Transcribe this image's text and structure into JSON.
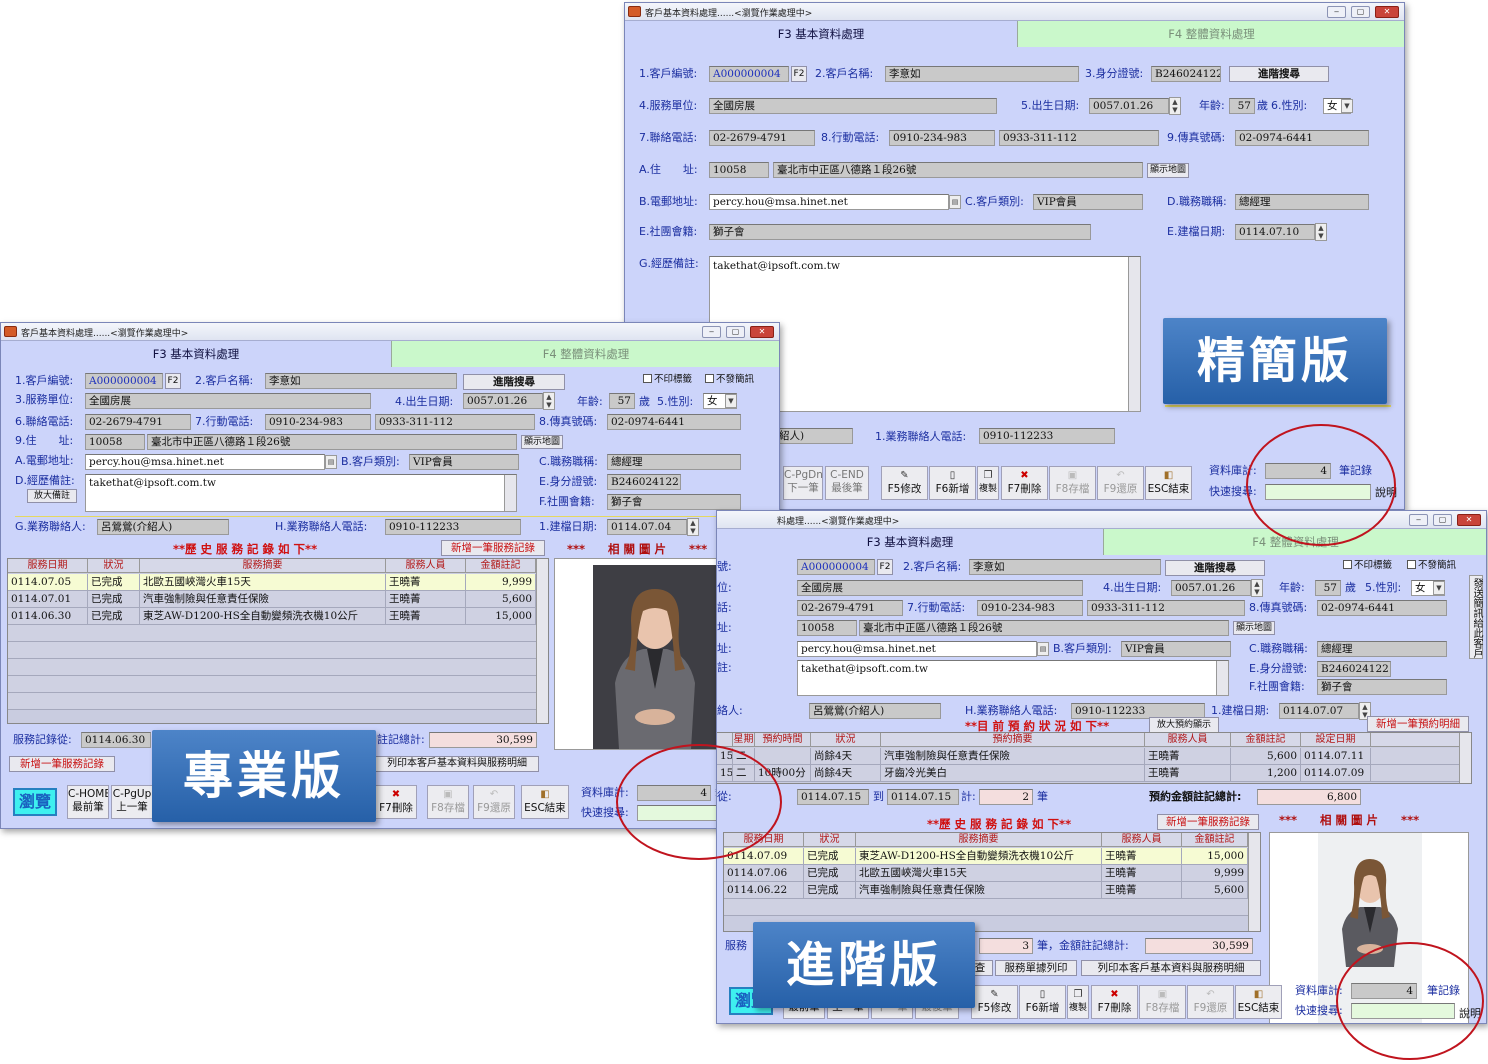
{
  "app": {
    "window_title": "客戶基本資料處理......<瀏覽作業處理中>",
    "tab_f3": "F3 基本資料處理",
    "tab_f4": "F4 整體資料處理"
  },
  "labels": {
    "cust_no": "1.客戶編號:",
    "cust_name": "2.客戶名稱:",
    "id_no": "3.身分證號:",
    "service_unit": "4.服務單位:",
    "birth": "5.出生日期:",
    "age": "年齡:",
    "age_unit": "歲",
    "gender": "6.性別:",
    "phone": "7.聯絡電話:",
    "mobile": "8.行動電話:",
    "fax": "9.傳真號碼:",
    "address": "A.住　　址:",
    "email": "B.電郵地址:",
    "cust_type": "C.客戶類別:",
    "job_title": "D.職務職稱:",
    "club": "E.社團會籍:",
    "build_date": "E.建檔日期:",
    "notes": "G.經歷備註:",
    "sales_phone": "1.業務聯絡人電話:",
    "p_cust_no": "1.客戶編號:",
    "p_cust_name": "2.客戶名稱:",
    "p_unit": "3.服務單位:",
    "p_birth": "4.出生日期:",
    "p_gender": "5.性別:",
    "p_phone": "6.聯絡電話:",
    "p_mobile": "7.行動電話:",
    "p_fax": "8.傳真號碼:",
    "p_address": "9.住　　址:",
    "p_email": "A.電郵地址:",
    "p_type": "B.客戶類別:",
    "p_job": "C.職務職稱:",
    "p_notes": "D.經歷備註:",
    "p_id": "E.身分證號:",
    "p_club": "F.社團會籍:",
    "p_sales": "G.業務聯絡人:",
    "p_sales_phone": "H.業務聯絡人電話:",
    "p_build": "1.建檔日期:",
    "a_cust_no": "號:",
    "a_unit": "位:",
    "a_phone": "話:",
    "a_addr": "址:",
    "a_email": "址:",
    "a_notes": "註:",
    "a_sales": "絡人:",
    "a_birth": "4.出生日期:",
    "a_mobile": "7.行動電話:",
    "a_fax": "8.傳真號碼:",
    "a_type": "B.客戶類別:",
    "a_job": "C.職務職稱:",
    "a_id": "E.身分證號:",
    "a_club": "F.社團會籍:",
    "a_sales_phone": "H.業務聯絡人電話:",
    "a_build": "1.建檔日期:",
    "a_name": "2.客戶名稱:",
    "a_age": "年齡:",
    "a_gender": "5.性別:",
    "a_title": "料處理......<瀏覽作業處理中>"
  },
  "values": {
    "cust_no": "A000000004",
    "f2": "F2",
    "cust_name": "李意如",
    "id_no": "B246024122",
    "unit": "全國房展",
    "birth_s": "0057.01.26",
    "age": "57",
    "gender": "女",
    "phone": "02-2679-4791",
    "mobile": "0910-234-983",
    "mobile2": "0933-311-112",
    "fax": "02-0974-6441",
    "zip": "10058",
    "address": "臺北市中正區八德路１段26號",
    "email": "percy.hou@msa.hinet.net",
    "cust_type": "VIP會員",
    "job": "總經理",
    "club": "獅子會",
    "build_s": "0114.07.10",
    "build_p": "0114.07.04",
    "build_a": "0114.07.07",
    "notes": "takethat@ipsoft.com.tw",
    "sales": "呂鶯鶯(介紹人)",
    "sales_frag": "紹人)",
    "sales_phone": "0910-112233"
  },
  "buttons": {
    "adv_search": "進階搜尋",
    "show_map": "顯示地圖",
    "enlarge_note": "放大備註",
    "no_label": "不印標籤",
    "no_sms": "不發簡訊",
    "send_sms": "發送簡訊給此客戶",
    "add_service": "新增一筆服務記錄",
    "print_detail": "列印本客戶基本資料與服務明細",
    "add_reserve": "新增一筆預約明細",
    "enlarge_reserve": "放大預約顯示",
    "print_service_form": "服務單據列印",
    "print_detail_a": "列印本客戶基本資料與服務明細",
    "edit_frag": "查"
  },
  "toolbar": {
    "browse": "瀏覽",
    "home": "C-HOME",
    "home2": "最前筆",
    "pgup": "C-PgUp",
    "pgup2": "上一筆",
    "pgdn": "C-PgDn",
    "pgdn2": "下一筆",
    "end": "C-END",
    "end2": "最後筆",
    "f5": "F5修改",
    "f6": "F6新增",
    "copy": "複製",
    "f7": "F7刪除",
    "f8": "F8存檔",
    "f9": "F9還原",
    "esc": "ESC結束",
    "total_label": "資料庫計:",
    "total": "4",
    "total_unit": "筆記錄",
    "quick": "快速搜尋:",
    "help": "說明",
    "a_first": "最前筆",
    "a_prev": "上一筆",
    "a_next": "下一筆",
    "a_last": "最後筆"
  },
  "service": {
    "title": "**歷 史 服 務 記 錄 如 下**",
    "photo_title": "***　　相 關 圖 片　　***",
    "headers": [
      "服務日期",
      "狀況",
      "服務摘要",
      "服務人員",
      "金額註記"
    ],
    "rows": [
      [
        "0114.07.05",
        "已完成",
        "北歐五國峽灣火車15天",
        "王曉菁",
        "9,999"
      ],
      [
        "0114.07.01",
        "已完成",
        "汽車強制險與任意責任保險",
        "王曉菁",
        "5,600"
      ],
      [
        "0114.06.30",
        "已完成",
        "東芝AW-D1200-HS全自動變頻洗衣機10公斤",
        "王曉菁",
        "15,000"
      ]
    ],
    "from_label": "服務記錄從:",
    "from": "0114.06.30",
    "total_label": "註記總計:",
    "total": "30,599"
  },
  "service_a": {
    "rows": [
      [
        "0114.07.09",
        "已完成",
        "東芝AW-D1200-HS全自動變頻洗衣機10公斤",
        "王曉菁",
        "15,000"
      ],
      [
        "0114.07.06",
        "已完成",
        "北歐五國峽灣火車15天",
        "王曉菁",
        "9,999"
      ],
      [
        "0114.06.22",
        "已完成",
        "汽車強制險與任意責任保險",
        "王曉菁",
        "5,600"
      ]
    ],
    "count": "3",
    "count_label": "筆，金額註記總計:",
    "total": "30,599",
    "frag": "服務"
  },
  "reserve": {
    "title": "**目 前 預 約 狀 況 如 下**",
    "headers": [
      "星期",
      "預約時間",
      "狀況",
      "預約摘要",
      "服務人員",
      "金額註記",
      "設定日期"
    ],
    "rows": [
      [
        "15",
        "二",
        "",
        "尚餘4天",
        "汽車強制險與任意責任保險",
        "王曉菁",
        "5,600",
        "0114.07.11"
      ],
      [
        "15",
        "二",
        "10時00分",
        "尚餘4天",
        "牙齒冷光美白",
        "王曉菁",
        "1,200",
        "0114.07.09"
      ]
    ],
    "from": "0114.07.15",
    "to_label": "到",
    "to": "0114.07.15",
    "cnt_label": "計:",
    "cnt": "2",
    "cnt_unit": "筆",
    "sum_label": "預約金額註記總計:",
    "sum": "6,800",
    "from_frag": "從:"
  },
  "banners": {
    "lite": "精簡版",
    "pro": "專業版",
    "adv": "進階版"
  }
}
